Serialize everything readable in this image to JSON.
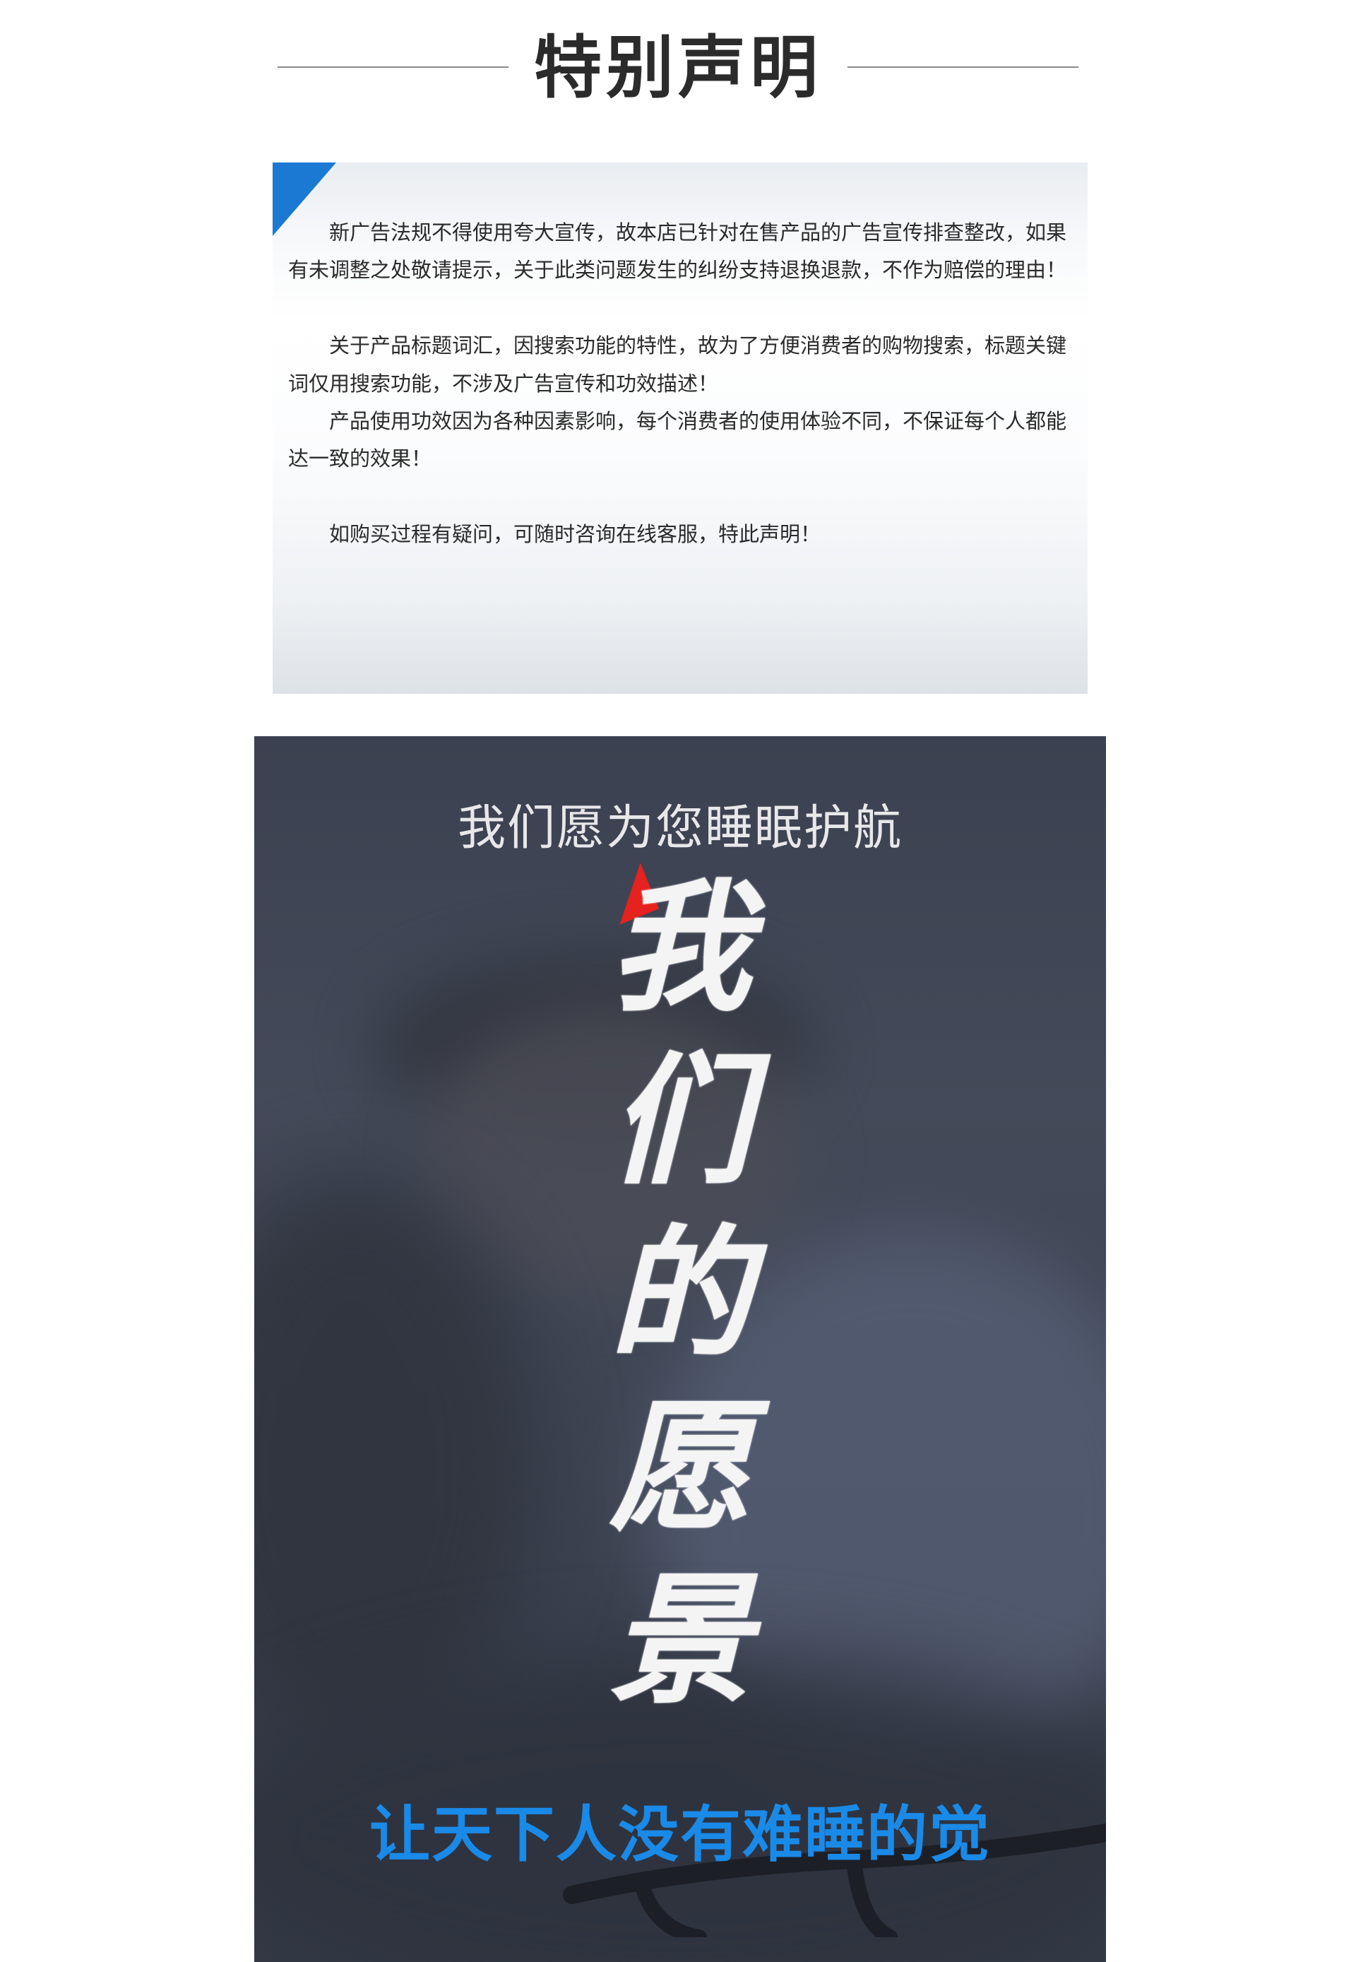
{
  "section_title": "特别声明",
  "notice": {
    "paragraphs": [
      "新广告法规不得使用夸大宣传，故本店已针对在售产品的广告宣传排查整改，如果有未调整之处敬请提示，关于此类问题发生的纠纷支持退换退款，不作为赔偿的理由！",
      "关于产品标题词汇，因搜索功能的特性，故为了方便消费者的购物搜索，标题关键词仅用搜索功能，不涉及广告宣传和功效描述！",
      "产品使用功效因为各种因素影响，每个消费者的使用体验不同，不保证每个人都能达一致的效果！",
      "如购买过程有疑问，可随时咨询在线客服，特此声明！"
    ]
  },
  "banner": {
    "subtitle": "我们愿为您睡眠护航",
    "calligraphy": [
      "我",
      "们",
      "的",
      "愿",
      "景"
    ],
    "slogan": "让天下人没有难睡的觉"
  },
  "colors": {
    "accent_blue": "#1b79d4",
    "slogan_blue": "#1a8ae8",
    "brush_red": "#e5221e",
    "banner_bg": "#3f4553"
  }
}
